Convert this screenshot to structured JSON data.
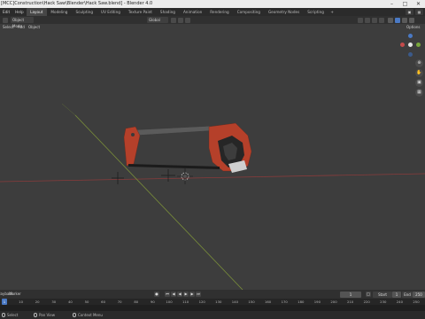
{
  "window": {
    "title": "[MCC]Construction\\Hack Saw\\Blender\\Hack Saw.blend] - Blender 4.0"
  },
  "topbar": {
    "menus": [
      "Edit",
      "Help"
    ],
    "tabs": [
      "Layout",
      "Modeling",
      "Sculpting",
      "UV Editing",
      "Texture Paint",
      "Shading",
      "Animation",
      "Rendering",
      "Compositing",
      "Geometry Nodes",
      "Scripting"
    ],
    "active_tab": "Layout",
    "add_tab": "+"
  },
  "header": {
    "mode": "Object Mode",
    "transform": "Global",
    "options": "Options"
  },
  "subheader": {
    "items": [
      "Select",
      "Add",
      "Object"
    ]
  },
  "viewport": {
    "gizmo_axes": [
      "Y",
      "X",
      "Z"
    ],
    "nav_buttons": [
      "zoom-icon",
      "hand-icon",
      "camera-icon",
      "grid-icon"
    ],
    "colors": {
      "background": "#3d3d3d",
      "x_axis": "#8a3b3b",
      "y_axis": "#7a8f3a",
      "saw_frame": "#5d5d5d",
      "saw_handle_red": "#b5402a",
      "saw_grip": "#2a2a2a",
      "blade": "#1b1b1b"
    }
  },
  "timeline": {
    "playback": "Playback",
    "marker": "Marker",
    "current_frame": "1",
    "start_label": "Start",
    "start_value": "1",
    "end_label": "End",
    "end_value": "250",
    "ruler_ticks": [
      "0",
      "10",
      "20",
      "30",
      "40",
      "50",
      "60",
      "70",
      "80",
      "90",
      "100",
      "110",
      "120",
      "130",
      "140",
      "150",
      "160",
      "170",
      "180",
      "190",
      "200",
      "210",
      "220",
      "230",
      "240",
      "250"
    ]
  },
  "statusbar": {
    "select": "Select",
    "pan": "Pan View",
    "context": "Context Menu"
  }
}
